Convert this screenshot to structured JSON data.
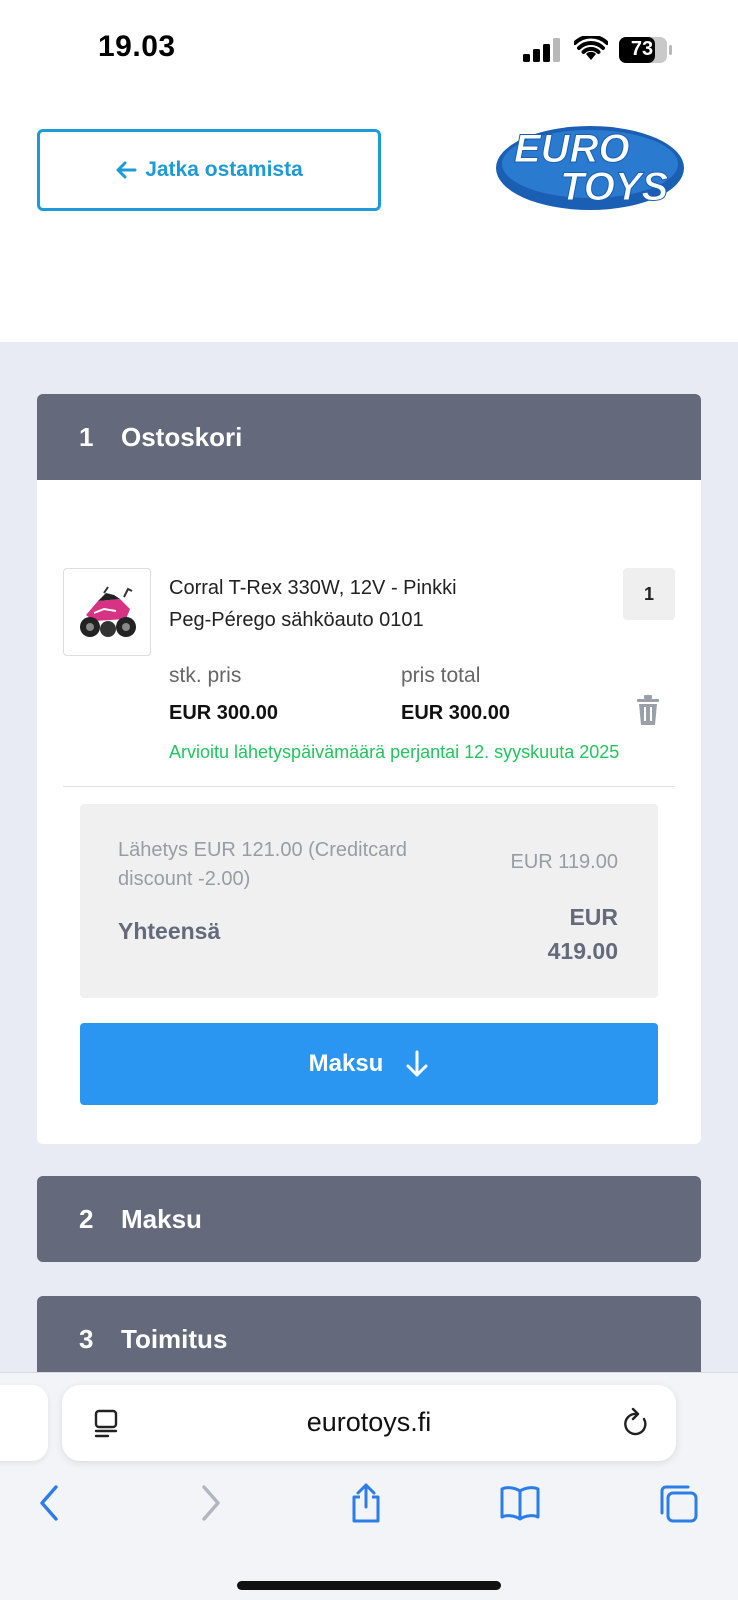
{
  "status_bar": {
    "time": "19.03",
    "battery": "73"
  },
  "header": {
    "continue_label": "Jatka ostamista",
    "logo_line1": "EURO",
    "logo_line2": "TOYS",
    "logo_color": "#1a5fb4"
  },
  "checkout": {
    "steps": [
      {
        "num": "1",
        "label": "Ostoskori"
      },
      {
        "num": "2",
        "label": "Maksu"
      },
      {
        "num": "3",
        "label": "Toimitus"
      }
    ],
    "item": {
      "name_line1": "Corral T-Rex 330W, 12V - Pinkki",
      "name_line2": "Peg-Pérego sähköauto 0101",
      "quantity": "1",
      "unit_price_label": "stk. pris",
      "unit_price": "EUR 300.00",
      "total_price_label": "pris total",
      "total_price": "EUR 300.00",
      "delivery_estimate": "Arvioitu lähetyspäivämäärä perjantai 12. syyskuuta 2025"
    },
    "summary": {
      "shipping_label": "Lähetys EUR 121.00 (Creditcard discount -2.00)",
      "shipping_amount": "EUR 119.00",
      "total_label": "Yhteensä",
      "total_amount": "EUR 419.00"
    },
    "pay_button_label": "Maksu"
  },
  "browser": {
    "url": "eurotoys.fi"
  },
  "colors": {
    "accent": "#1e9bd7",
    "pay_button": "#2b96f2",
    "step_header": "#646a7b",
    "delivery_green": "#22c55e",
    "page_background": "#e8ebf3"
  },
  "icons": [
    "signal-icon",
    "wifi-icon",
    "battery-icon",
    "arrow-left-icon",
    "trash-icon",
    "arrow-down-icon",
    "reader-icon",
    "reload-icon",
    "back-icon",
    "forward-icon",
    "share-icon",
    "bookmarks-icon",
    "tabs-icon"
  ]
}
